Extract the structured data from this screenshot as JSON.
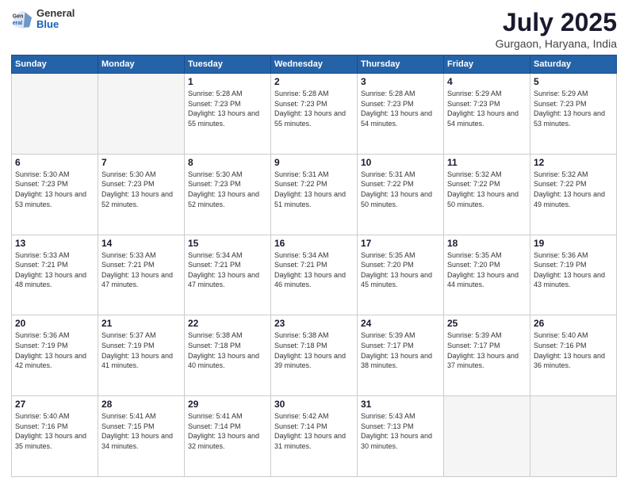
{
  "header": {
    "logo_general": "General",
    "logo_blue": "Blue",
    "title": "July 2025",
    "subtitle": "Gurgaon, Haryana, India"
  },
  "weekdays": [
    "Sunday",
    "Monday",
    "Tuesday",
    "Wednesday",
    "Thursday",
    "Friday",
    "Saturday"
  ],
  "weeks": [
    [
      {
        "day": "",
        "info": ""
      },
      {
        "day": "",
        "info": ""
      },
      {
        "day": "1",
        "info": "Sunrise: 5:28 AM\nSunset: 7:23 PM\nDaylight: 13 hours and 55 minutes."
      },
      {
        "day": "2",
        "info": "Sunrise: 5:28 AM\nSunset: 7:23 PM\nDaylight: 13 hours and 55 minutes."
      },
      {
        "day": "3",
        "info": "Sunrise: 5:28 AM\nSunset: 7:23 PM\nDaylight: 13 hours and 54 minutes."
      },
      {
        "day": "4",
        "info": "Sunrise: 5:29 AM\nSunset: 7:23 PM\nDaylight: 13 hours and 54 minutes."
      },
      {
        "day": "5",
        "info": "Sunrise: 5:29 AM\nSunset: 7:23 PM\nDaylight: 13 hours and 53 minutes."
      }
    ],
    [
      {
        "day": "6",
        "info": "Sunrise: 5:30 AM\nSunset: 7:23 PM\nDaylight: 13 hours and 53 minutes."
      },
      {
        "day": "7",
        "info": "Sunrise: 5:30 AM\nSunset: 7:23 PM\nDaylight: 13 hours and 52 minutes."
      },
      {
        "day": "8",
        "info": "Sunrise: 5:30 AM\nSunset: 7:23 PM\nDaylight: 13 hours and 52 minutes."
      },
      {
        "day": "9",
        "info": "Sunrise: 5:31 AM\nSunset: 7:22 PM\nDaylight: 13 hours and 51 minutes."
      },
      {
        "day": "10",
        "info": "Sunrise: 5:31 AM\nSunset: 7:22 PM\nDaylight: 13 hours and 50 minutes."
      },
      {
        "day": "11",
        "info": "Sunrise: 5:32 AM\nSunset: 7:22 PM\nDaylight: 13 hours and 50 minutes."
      },
      {
        "day": "12",
        "info": "Sunrise: 5:32 AM\nSunset: 7:22 PM\nDaylight: 13 hours and 49 minutes."
      }
    ],
    [
      {
        "day": "13",
        "info": "Sunrise: 5:33 AM\nSunset: 7:21 PM\nDaylight: 13 hours and 48 minutes."
      },
      {
        "day": "14",
        "info": "Sunrise: 5:33 AM\nSunset: 7:21 PM\nDaylight: 13 hours and 47 minutes."
      },
      {
        "day": "15",
        "info": "Sunrise: 5:34 AM\nSunset: 7:21 PM\nDaylight: 13 hours and 47 minutes."
      },
      {
        "day": "16",
        "info": "Sunrise: 5:34 AM\nSunset: 7:21 PM\nDaylight: 13 hours and 46 minutes."
      },
      {
        "day": "17",
        "info": "Sunrise: 5:35 AM\nSunset: 7:20 PM\nDaylight: 13 hours and 45 minutes."
      },
      {
        "day": "18",
        "info": "Sunrise: 5:35 AM\nSunset: 7:20 PM\nDaylight: 13 hours and 44 minutes."
      },
      {
        "day": "19",
        "info": "Sunrise: 5:36 AM\nSunset: 7:19 PM\nDaylight: 13 hours and 43 minutes."
      }
    ],
    [
      {
        "day": "20",
        "info": "Sunrise: 5:36 AM\nSunset: 7:19 PM\nDaylight: 13 hours and 42 minutes."
      },
      {
        "day": "21",
        "info": "Sunrise: 5:37 AM\nSunset: 7:19 PM\nDaylight: 13 hours and 41 minutes."
      },
      {
        "day": "22",
        "info": "Sunrise: 5:38 AM\nSunset: 7:18 PM\nDaylight: 13 hours and 40 minutes."
      },
      {
        "day": "23",
        "info": "Sunrise: 5:38 AM\nSunset: 7:18 PM\nDaylight: 13 hours and 39 minutes."
      },
      {
        "day": "24",
        "info": "Sunrise: 5:39 AM\nSunset: 7:17 PM\nDaylight: 13 hours and 38 minutes."
      },
      {
        "day": "25",
        "info": "Sunrise: 5:39 AM\nSunset: 7:17 PM\nDaylight: 13 hours and 37 minutes."
      },
      {
        "day": "26",
        "info": "Sunrise: 5:40 AM\nSunset: 7:16 PM\nDaylight: 13 hours and 36 minutes."
      }
    ],
    [
      {
        "day": "27",
        "info": "Sunrise: 5:40 AM\nSunset: 7:16 PM\nDaylight: 13 hours and 35 minutes."
      },
      {
        "day": "28",
        "info": "Sunrise: 5:41 AM\nSunset: 7:15 PM\nDaylight: 13 hours and 34 minutes."
      },
      {
        "day": "29",
        "info": "Sunrise: 5:41 AM\nSunset: 7:14 PM\nDaylight: 13 hours and 32 minutes."
      },
      {
        "day": "30",
        "info": "Sunrise: 5:42 AM\nSunset: 7:14 PM\nDaylight: 13 hours and 31 minutes."
      },
      {
        "day": "31",
        "info": "Sunrise: 5:43 AM\nSunset: 7:13 PM\nDaylight: 13 hours and 30 minutes."
      },
      {
        "day": "",
        "info": ""
      },
      {
        "day": "",
        "info": ""
      }
    ]
  ]
}
